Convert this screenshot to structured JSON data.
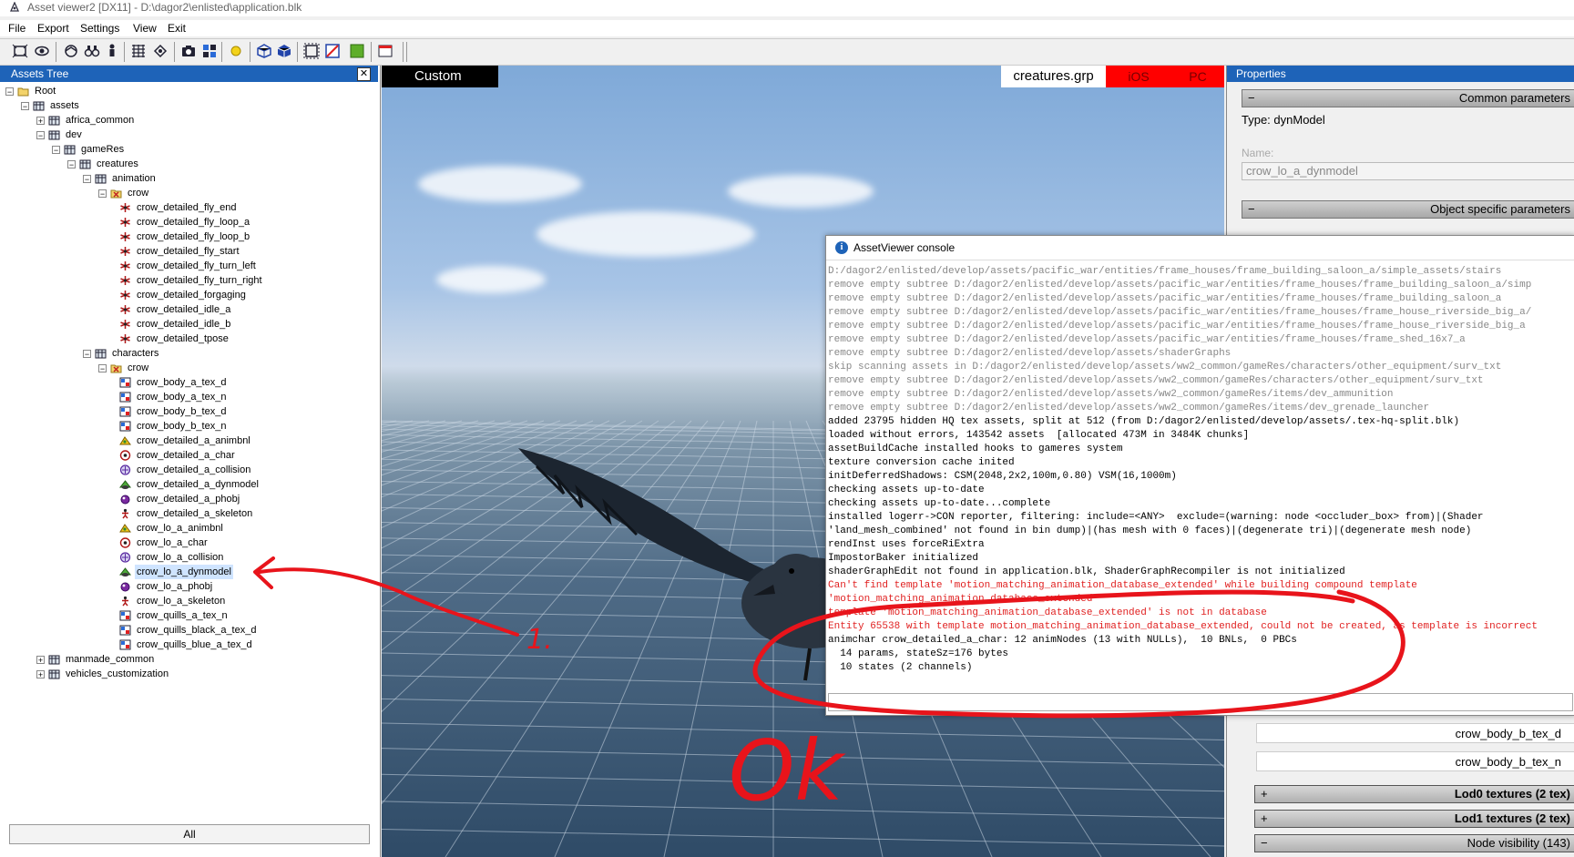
{
  "window": {
    "title": "Asset viewer2  [DX11]  - D:\\dagor2\\enlisted\\application.blk"
  },
  "menu": {
    "items": [
      "File",
      "Export",
      "Settings",
      "View",
      "Exit"
    ]
  },
  "assets_tree": {
    "title": "Assets Tree",
    "close_label": "✕",
    "all_button": "All",
    "nodes": [
      {
        "label": "Root",
        "depth": 0,
        "expander": "−",
        "icon": "folder-icon"
      },
      {
        "label": "assets",
        "depth": 1,
        "expander": "−",
        "icon": "package-icon"
      },
      {
        "label": "africa_common",
        "depth": 2,
        "expander": "+",
        "icon": "package-icon"
      },
      {
        "label": "dev",
        "depth": 2,
        "expander": "−",
        "icon": "package-icon"
      },
      {
        "label": "gameRes",
        "depth": 3,
        "expander": "−",
        "icon": "package-icon"
      },
      {
        "label": "creatures",
        "depth": 4,
        "expander": "−",
        "icon": "package-icon"
      },
      {
        "label": "animation",
        "depth": 5,
        "expander": "−",
        "icon": "package-icon"
      },
      {
        "label": "crow",
        "depth": 6,
        "expander": "−",
        "icon": "folder-x-icon"
      },
      {
        "label": "crow_detailed_fly_end",
        "depth": 7,
        "expander": "",
        "icon": "animation-icon"
      },
      {
        "label": "crow_detailed_fly_loop_a",
        "depth": 7,
        "expander": "",
        "icon": "animation-icon"
      },
      {
        "label": "crow_detailed_fly_loop_b",
        "depth": 7,
        "expander": "",
        "icon": "animation-icon"
      },
      {
        "label": "crow_detailed_fly_start",
        "depth": 7,
        "expander": "",
        "icon": "animation-icon"
      },
      {
        "label": "crow_detailed_fly_turn_left",
        "depth": 7,
        "expander": "",
        "icon": "animation-icon"
      },
      {
        "label": "crow_detailed_fly_turn_right",
        "depth": 7,
        "expander": "",
        "icon": "animation-icon"
      },
      {
        "label": "crow_detailed_forgaging",
        "depth": 7,
        "expander": "",
        "icon": "animation-icon"
      },
      {
        "label": "crow_detailed_idle_a",
        "depth": 7,
        "expander": "",
        "icon": "animation-icon"
      },
      {
        "label": "crow_detailed_idle_b",
        "depth": 7,
        "expander": "",
        "icon": "animation-icon"
      },
      {
        "label": "crow_detailed_tpose",
        "depth": 7,
        "expander": "",
        "icon": "animation-icon"
      },
      {
        "label": "characters",
        "depth": 5,
        "expander": "−",
        "icon": "package-icon"
      },
      {
        "label": "crow",
        "depth": 6,
        "expander": "−",
        "icon": "folder-x-icon"
      },
      {
        "label": "crow_body_a_tex_d",
        "depth": 7,
        "expander": "",
        "icon": "texture-icon"
      },
      {
        "label": "crow_body_a_tex_n",
        "depth": 7,
        "expander": "",
        "icon": "texture-icon"
      },
      {
        "label": "crow_body_b_tex_d",
        "depth": 7,
        "expander": "",
        "icon": "texture-icon"
      },
      {
        "label": "crow_body_b_tex_n",
        "depth": 7,
        "expander": "",
        "icon": "texture-icon"
      },
      {
        "label": "crow_detailed_a_animbnl",
        "depth": 7,
        "expander": "",
        "icon": "animbnl-icon"
      },
      {
        "label": "crow_detailed_a_char",
        "depth": 7,
        "expander": "",
        "icon": "char-icon"
      },
      {
        "label": "crow_detailed_a_collision",
        "depth": 7,
        "expander": "",
        "icon": "collision-icon"
      },
      {
        "label": "crow_detailed_a_dynmodel",
        "depth": 7,
        "expander": "",
        "icon": "dynmodel-icon"
      },
      {
        "label": "crow_detailed_a_phobj",
        "depth": 7,
        "expander": "",
        "icon": "phobj-icon"
      },
      {
        "label": "crow_detailed_a_skeleton",
        "depth": 7,
        "expander": "",
        "icon": "skeleton-icon"
      },
      {
        "label": "crow_lo_a_animbnl",
        "depth": 7,
        "expander": "",
        "icon": "animbnl-icon"
      },
      {
        "label": "crow_lo_a_char",
        "depth": 7,
        "expander": "",
        "icon": "char-icon"
      },
      {
        "label": "crow_lo_a_collision",
        "depth": 7,
        "expander": "",
        "icon": "collision-icon"
      },
      {
        "label": "crow_lo_a_dynmodel",
        "depth": 7,
        "expander": "",
        "icon": "dynmodel-icon",
        "selected": true
      },
      {
        "label": "crow_lo_a_phobj",
        "depth": 7,
        "expander": "",
        "icon": "phobj-icon"
      },
      {
        "label": "crow_lo_a_skeleton",
        "depth": 7,
        "expander": "",
        "icon": "skeleton-icon"
      },
      {
        "label": "crow_quills_a_tex_n",
        "depth": 7,
        "expander": "",
        "icon": "texture-icon"
      },
      {
        "label": "crow_quills_black_a_tex_d",
        "depth": 7,
        "expander": "",
        "icon": "texture-icon"
      },
      {
        "label": "crow_quills_blue_a_tex_d",
        "depth": 7,
        "expander": "",
        "icon": "texture-icon"
      },
      {
        "label": "manmade_common",
        "depth": 2,
        "expander": "+",
        "icon": "package-icon"
      },
      {
        "label": "vehicles_customization",
        "depth": 2,
        "expander": "+",
        "icon": "package-icon"
      }
    ]
  },
  "viewport": {
    "mode_label": "Custom",
    "group_label": "creatures.grp",
    "platform_ios": "iOS",
    "platform_pc": "PC"
  },
  "properties": {
    "title": "Properties",
    "common_section": "Common parameters",
    "type_text": "Type: dynModel",
    "name_label": "Name:",
    "name_value": "crow_lo_a_dynmodel",
    "object_section": "Object specific parameters",
    "texture_buttons": [
      "crow_body_b_tex_d",
      "crow_body_b_tex_n"
    ],
    "lod0": "Lod0 textures (2 tex)",
    "lod1": "Lod1 textures (2 tex)",
    "node_visibility": "Node visibility (143)"
  },
  "console": {
    "title": "AssetViewer console",
    "lines": [
      {
        "text": "D:/dagor2/enlisted/develop/assets/pacific_war/entities/frame_houses/frame_building_saloon_a/simple_assets/stairs",
        "kind": "grey"
      },
      {
        "text": "remove empty subtree D:/dagor2/enlisted/develop/assets/pacific_war/entities/frame_houses/frame_building_saloon_a/simp",
        "kind": "grey"
      },
      {
        "text": "remove empty subtree D:/dagor2/enlisted/develop/assets/pacific_war/entities/frame_houses/frame_building_saloon_a",
        "kind": "grey"
      },
      {
        "text": "remove empty subtree D:/dagor2/enlisted/develop/assets/pacific_war/entities/frame_houses/frame_house_riverside_big_a/",
        "kind": "grey"
      },
      {
        "text": "remove empty subtree D:/dagor2/enlisted/develop/assets/pacific_war/entities/frame_houses/frame_house_riverside_big_a",
        "kind": "grey"
      },
      {
        "text": "remove empty subtree D:/dagor2/enlisted/develop/assets/pacific_war/entities/frame_houses/frame_shed_16x7_a",
        "kind": "grey"
      },
      {
        "text": "remove empty subtree D:/dagor2/enlisted/develop/assets/shaderGraphs",
        "kind": "grey"
      },
      {
        "text": "skip scanning assets in D:/dagor2/enlisted/develop/assets/ww2_common/gameRes/characters/other_equipment/surv_txt",
        "kind": "grey"
      },
      {
        "text": "remove empty subtree D:/dagor2/enlisted/develop/assets/ww2_common/gameRes/characters/other_equipment/surv_txt",
        "kind": "grey"
      },
      {
        "text": "remove empty subtree D:/dagor2/enlisted/develop/assets/ww2_common/gameRes/items/dev_ammunition",
        "kind": "grey"
      },
      {
        "text": "remove empty subtree D:/dagor2/enlisted/develop/assets/ww2_common/gameRes/items/dev_grenade_launcher",
        "kind": "grey"
      },
      {
        "text": "added 23795 hidden HQ tex assets, split at 512 (from D:/dagor2/enlisted/develop/assets/.tex-hq-split.blk)",
        "kind": "black"
      },
      {
        "text": "loaded without errors, 143542 assets  [allocated 473M in 3484K chunks]",
        "kind": "black"
      },
      {
        "text": "assetBuildCache installed hooks to gameres system",
        "kind": "black"
      },
      {
        "text": "texture conversion cache inited",
        "kind": "black"
      },
      {
        "text": "initDeferredShadows: CSM(2048,2x2,100m,0.80) VSM(16,1000m)",
        "kind": "black"
      },
      {
        "text": "checking assets up-to-date",
        "kind": "black"
      },
      {
        "text": "checking assets up-to-date...complete",
        "kind": "black"
      },
      {
        "text": "installed logerr->CON reporter, filtering: include=<ANY>  exclude=(warning: node <occluder_box> from)|(Shader",
        "kind": "black"
      },
      {
        "text": "'land_mesh_combined' not found in bin dump)|(has mesh with 0 faces)|(degenerate tri)|(degenerate mesh node)",
        "kind": "black"
      },
      {
        "text": "rendInst uses forceRiExtra",
        "kind": "black"
      },
      {
        "text": "ImpostorBaker initialized",
        "kind": "black"
      },
      {
        "text": "shaderGraphEdit not found in application.blk, ShaderGraphRecompiler is not initialized",
        "kind": "black"
      },
      {
        "text": "Can't find template 'motion_matching_animation_database_extended' while building compound template",
        "kind": "red"
      },
      {
        "text": "'motion_matching_animation_database_extended'",
        "kind": "red"
      },
      {
        "text": "template 'motion_matching_animation_database_extended' is not in database",
        "kind": "red"
      },
      {
        "text": "Entity 65538 with template motion_matching_animation_database_extended, could not be created, as template is incorrect",
        "kind": "red"
      },
      {
        "text": "animchar crow_detailed_a_char: 12 animNodes (13 with NULLs),  10 BNLs,  0 PBCs",
        "kind": "black"
      },
      {
        "text": "  14 params, stateSz=176 bytes",
        "kind": "black"
      },
      {
        "text": "  10 states (2 channels)",
        "kind": "black"
      }
    ]
  },
  "annotations": {
    "number_label": "1.",
    "ok_text": "Ok",
    "color": "#e8141b"
  }
}
